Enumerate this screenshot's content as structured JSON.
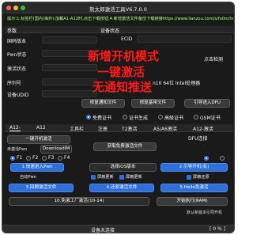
{
  "window": {
    "title": "熊太郎激活工具V6.7.0.0"
  },
  "marquee": "提示:1.标签栏(国内/海外):加載A1-A12时,点击下载按钮,4.新增激活文件备份下载链接https://www.lianzou.com/s/fo0ncfm",
  "device_panel": {
    "header_left": "参数",
    "header_right": "设备状态",
    "fields": [
      {
        "label": "国码版本"
      },
      {
        "label": "Pwn状态"
      },
      {
        "label": "激活状态"
      },
      {
        "label": "序列号"
      },
      {
        "label": "设备UDID"
      }
    ],
    "ecid_label": "ECID",
    "mode_label": "点击检测",
    "chip_info": "n10 64位 Intel处理器"
  },
  "overlay": {
    "line1": "新增开机模式",
    "line2": "一键激活",
    "line3": "无通知推送"
  },
  "mid_buttons": {
    "fix_notify": "修复通知文件",
    "fix_baseband": "修复基带文件",
    "dfu_enter": "引导进入DFU"
  },
  "radio_options": {
    "opt1": "免费证书",
    "opt2": "证书生成",
    "opt3": "高级证书",
    "opt4": "GSM证书"
  },
  "tabs": [
    "A12-",
    "A12",
    "工具栏",
    "注册",
    "T2激活",
    "A5/A6激活",
    "A12-激活"
  ],
  "main": {
    "one_click": "一键开机激活",
    "sub_left": "未激活Pwn",
    "sub_right": "DownloadIM",
    "get_file": "获取免费激活文件",
    "dfu_label": "DFU连接",
    "radios": [
      "F1",
      "F2",
      "F3",
      "F4"
    ],
    "btn1": "1.快速进入Pwn",
    "btn2": "选择iOS版本",
    "btn3": "2.引导开机(有)",
    "pwn_label": "自动Pwn",
    "chk_labels": [
      "屏蔽更新",
      "屏蔽更新",
      "屏蔽还原"
    ],
    "btn4": "3.回顾激活文件",
    "btn5": "4.还原激活文件",
    "btn6": "5.Hello免激活",
    "select10": "10.免激工厂激活(10-14)",
    "ram_label": "开始执行(RAM)",
    "note": "默认新版本引导开机"
  },
  "status": {
    "text": "设备未连接",
    "right": "[ 0 % ]"
  },
  "colors": {
    "accent": "#2f6fd6",
    "overlay": "#ff1a1a",
    "background": "#1a1a1a"
  }
}
